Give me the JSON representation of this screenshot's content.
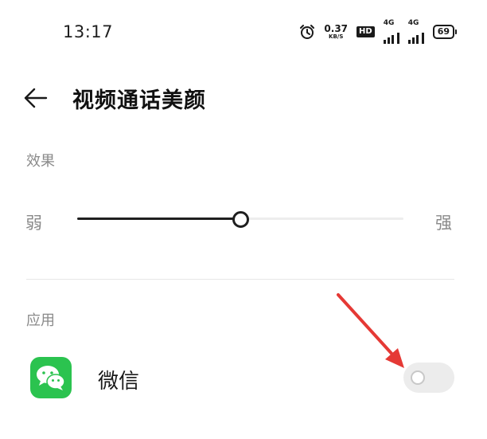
{
  "status_bar": {
    "time": "13:17",
    "speed_value": "0.37",
    "speed_unit": "KB/S",
    "hd_label": "HD",
    "signal1_label": "4G",
    "signal2_label": "4G",
    "battery_level": "69",
    "alarm_icon": "alarm-clock-icon"
  },
  "header": {
    "title": "视频通话美颜",
    "back_icon": "arrow-left-icon"
  },
  "effect": {
    "section_label": "效果",
    "min_label": "弱",
    "max_label": "强",
    "level": 0.5
  },
  "apps": {
    "section_label": "应用",
    "items": [
      {
        "name": "微信",
        "icon": "wechat-icon",
        "enabled": false
      }
    ]
  },
  "annotation": {
    "arrow_color": "#e53935"
  },
  "colors": {
    "wechat_green": "#2bc34f",
    "toggle_off": "#ececec"
  }
}
